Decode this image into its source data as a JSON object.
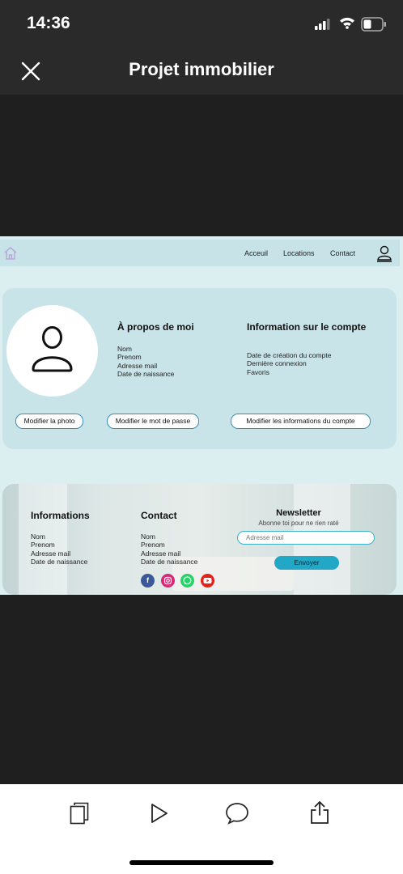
{
  "status_bar": {
    "time": "14:36"
  },
  "header": {
    "title": "Projet immobilier"
  },
  "site": {
    "nav": {
      "items": [
        "Acceuil",
        "Locations",
        "Contact"
      ]
    },
    "about": {
      "title": "À propos de moi",
      "fields": [
        "Nom",
        "Prenom",
        "Adresse mail",
        "Date de naissance"
      ]
    },
    "account": {
      "title": "Information sur le compte",
      "fields": [
        "Date de création du compte",
        "Dernière connexion",
        "Favoris"
      ]
    },
    "buttons": {
      "photo": "Modifier la photo",
      "password": "Modifier le mot de passe",
      "info": "Modifier les informations du compte"
    },
    "footer": {
      "informations": {
        "title": "Informations",
        "fields": [
          "Nom",
          "Prenom",
          "Adresse mail",
          "Date de naissance"
        ]
      },
      "contact": {
        "title": "Contact",
        "fields": [
          "Nom",
          "Prenom",
          "Adresse mail",
          "Date de naissance"
        ],
        "social": [
          {
            "icon": "facebook-icon",
            "color": "#3b5998"
          },
          {
            "icon": "instagram-icon",
            "color": "#d62976"
          },
          {
            "icon": "whatsapp-icon",
            "color": "#25d366"
          },
          {
            "icon": "youtube-icon",
            "color": "#e62117"
          }
        ]
      },
      "newsletter": {
        "title": "Newsletter",
        "subtitle": "Abonne toi pour ne rien raté",
        "placeholder": "Adresse mail",
        "button": "Envoyer"
      }
    }
  },
  "toolbar": {
    "icons": [
      "pages-icon",
      "play-icon",
      "comment-icon",
      "share-icon"
    ]
  },
  "colors": {
    "accent": "#22a7c7",
    "app_bg": "#dbeef0",
    "card_bg": "#c9e4e9"
  }
}
